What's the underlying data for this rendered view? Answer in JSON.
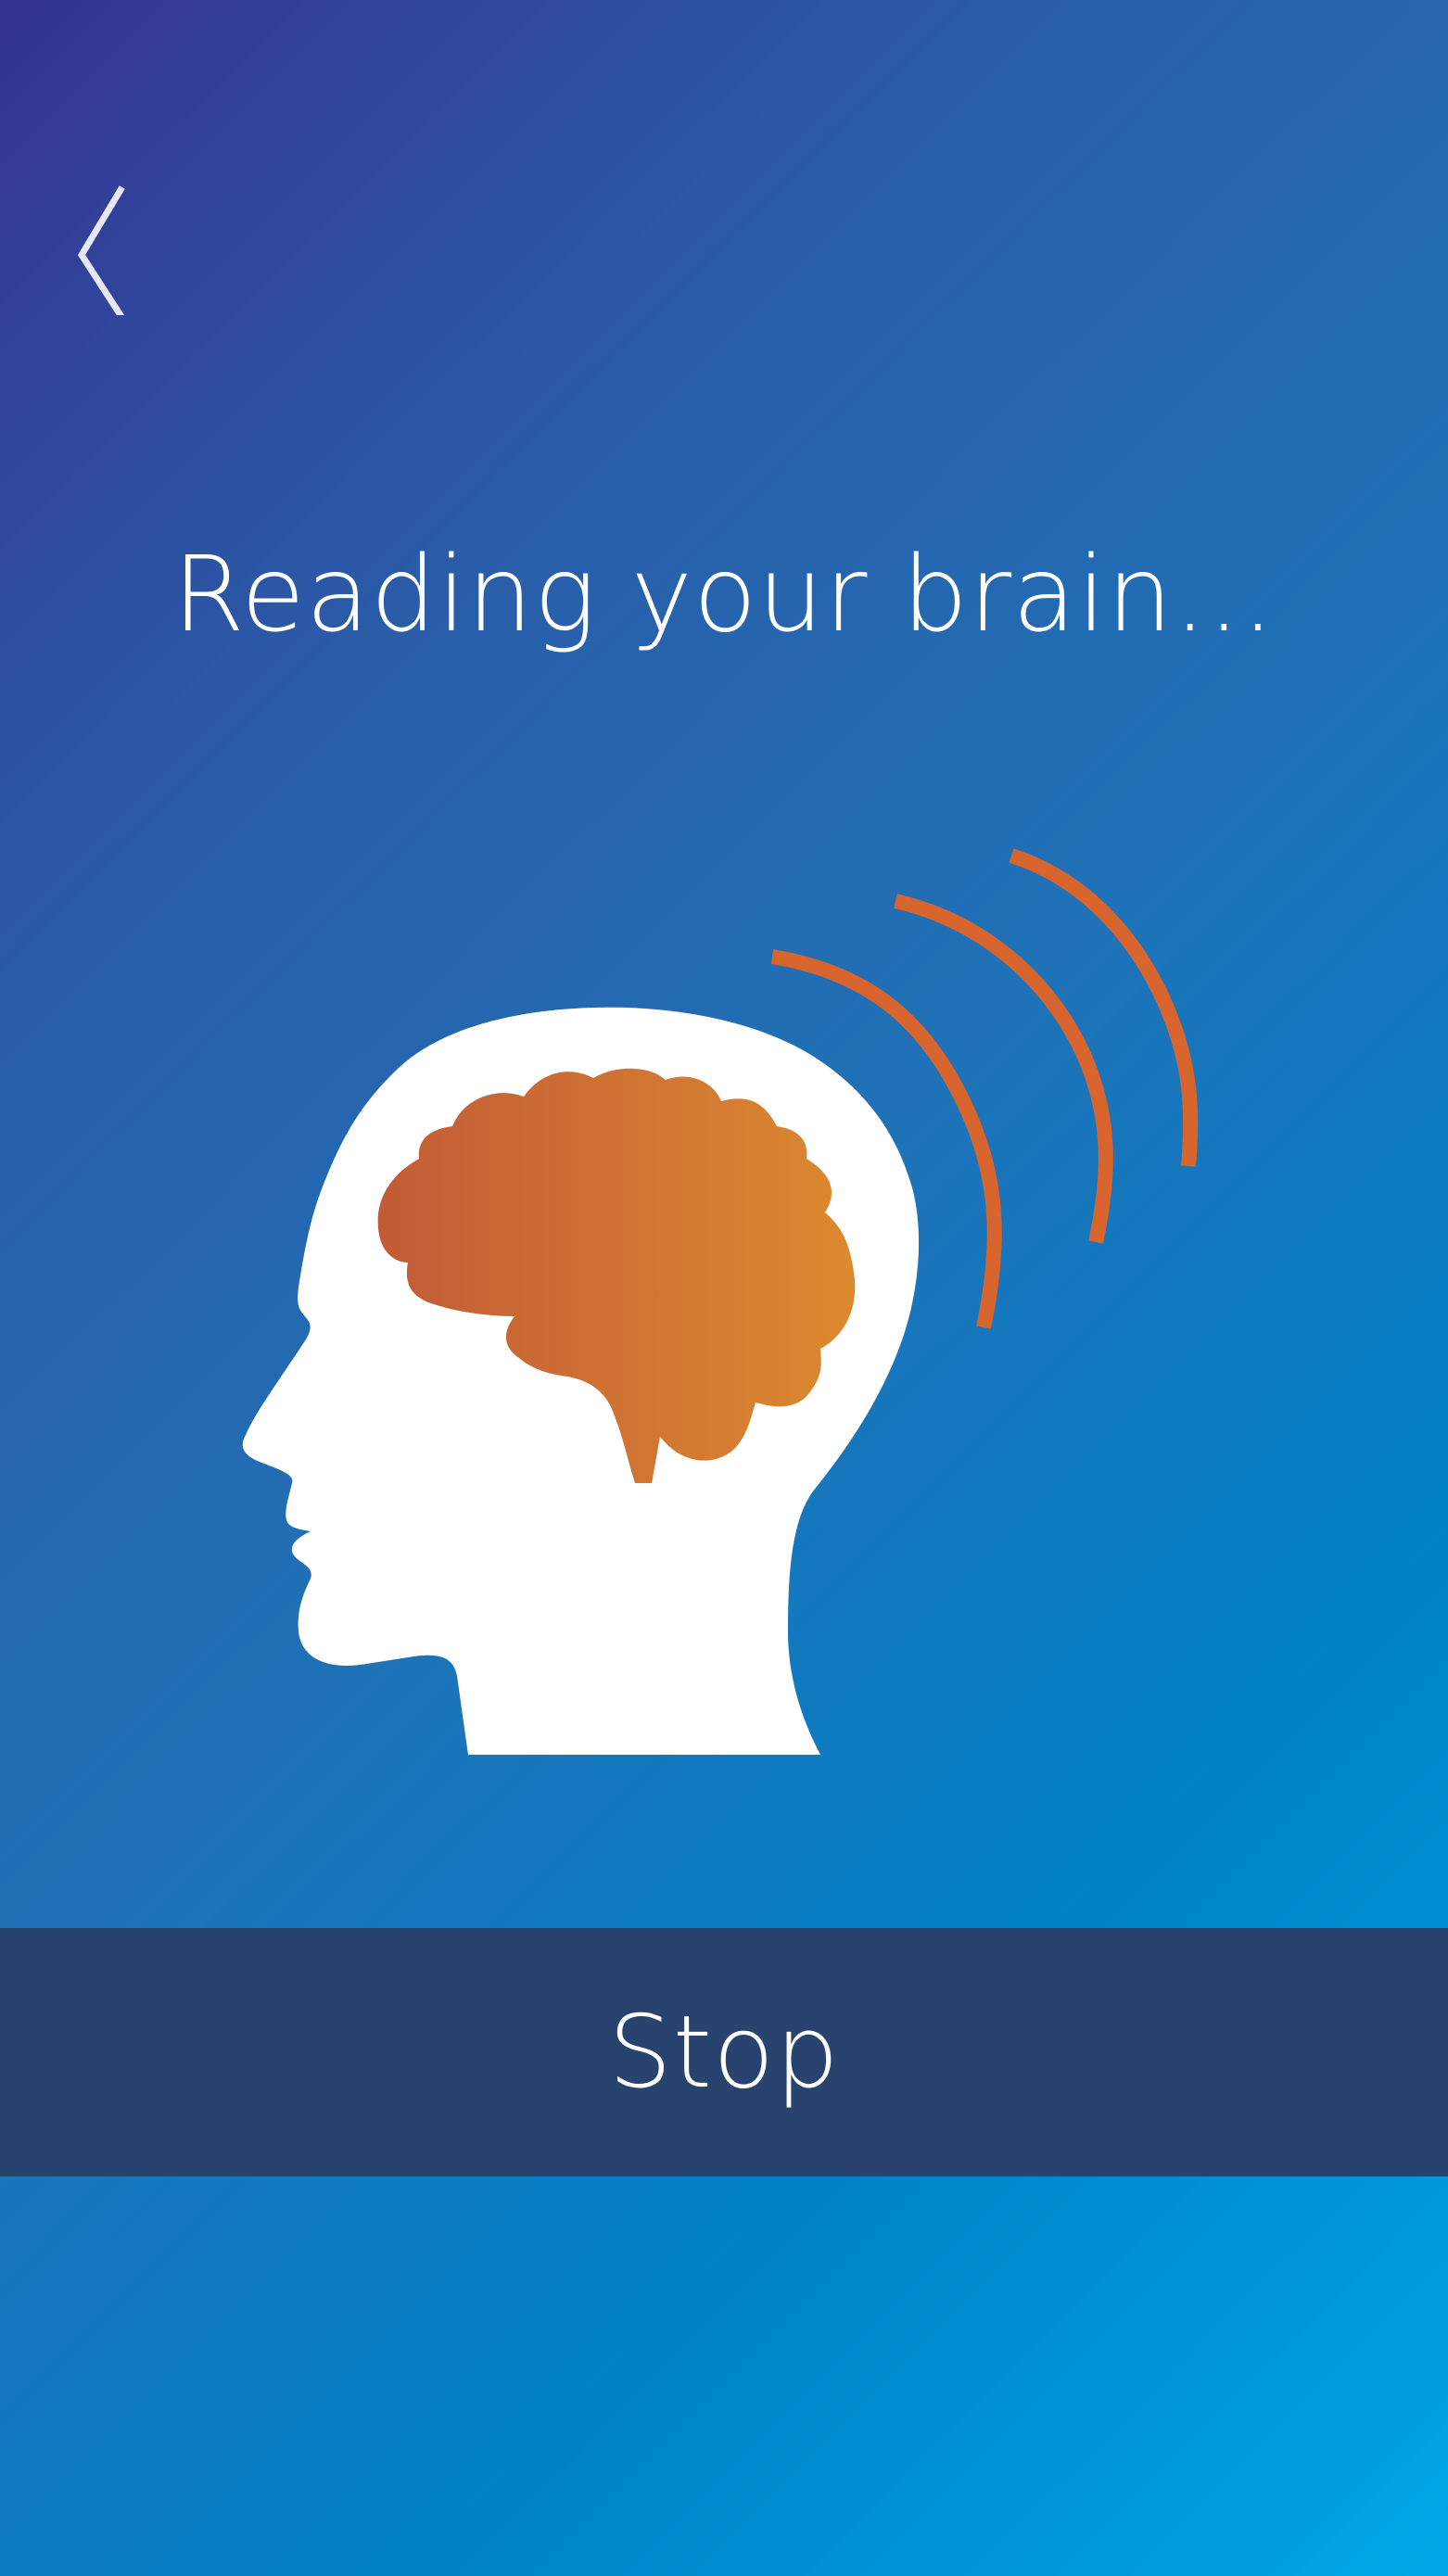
{
  "header": {
    "back_icon": "chevron-left-icon"
  },
  "main": {
    "title": "Reading your brain...",
    "illustration": {
      "head_icon": "head-silhouette-icon",
      "brain_icon": "brain-icon",
      "waves_icon": "signal-waves-icon",
      "colors": {
        "head": "#ffffff",
        "brain_start": "#c25b36",
        "brain_end": "#dc8a30",
        "waves": "#d9652e"
      }
    }
  },
  "action": {
    "stop_label": "Stop"
  },
  "colors": {
    "background_start": "#353393",
    "background_end": "#00a7e6",
    "stop_bar": "#27436e",
    "text": "#ffffff"
  }
}
